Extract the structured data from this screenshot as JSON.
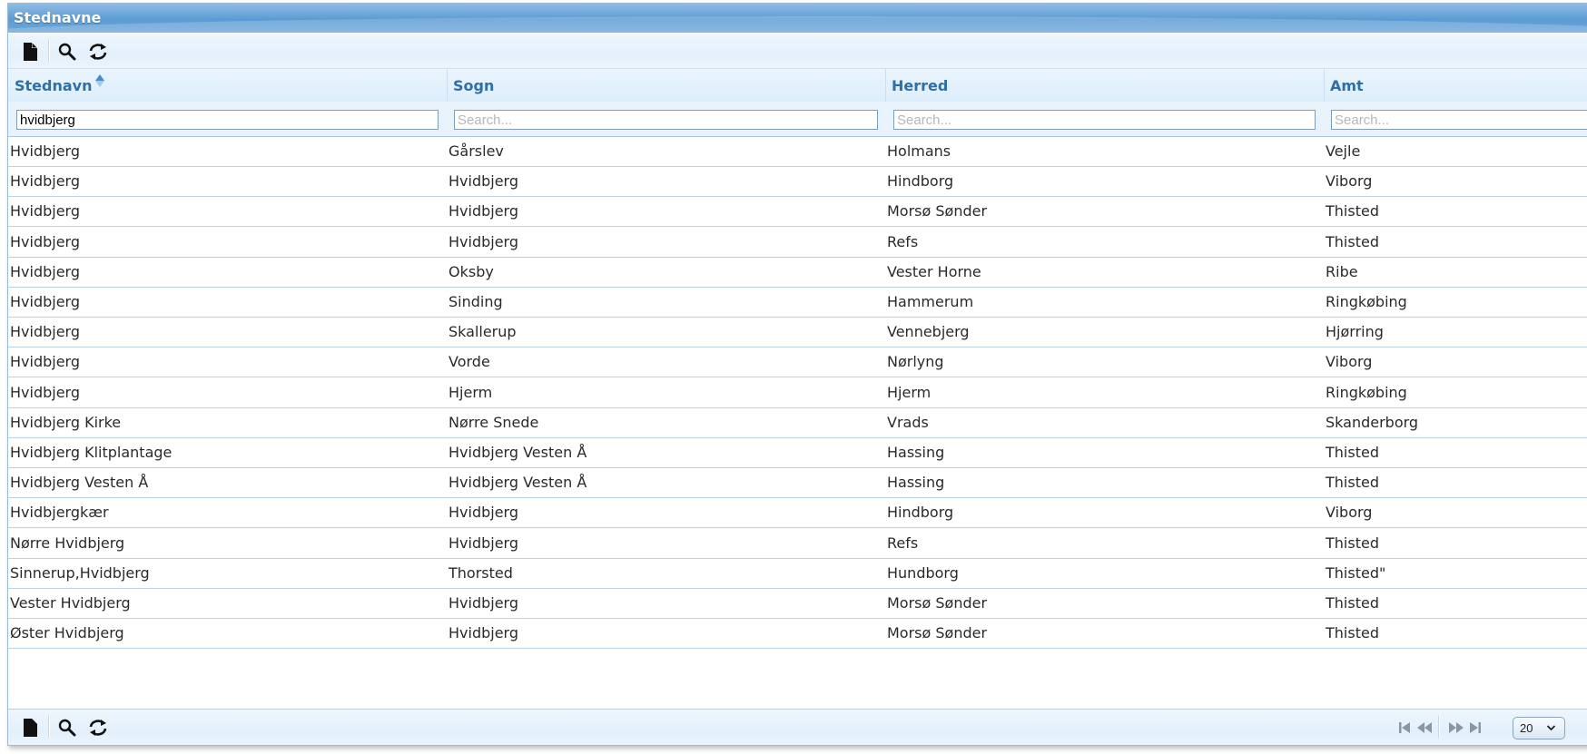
{
  "window": {
    "title": "Stednavne"
  },
  "toolbar": {
    "icons": [
      "new-document-icon",
      "search-icon",
      "refresh-icon"
    ]
  },
  "columns": [
    {
      "label": "Stednavn",
      "filter_value": "hvidbjerg",
      "placeholder": "Search...",
      "sorted": "ascending"
    },
    {
      "label": "Sogn",
      "filter_value": "",
      "placeholder": "Search..."
    },
    {
      "label": "Herred",
      "filter_value": "",
      "placeholder": "Search..."
    },
    {
      "label": "Amt",
      "filter_value": "",
      "placeholder": "Search..."
    }
  ],
  "rows": [
    [
      "Hvidbjerg",
      "Gårslev",
      "Holmans",
      "Vejle"
    ],
    [
      "Hvidbjerg",
      "Hvidbjerg",
      "Hindborg",
      "Viborg"
    ],
    [
      "Hvidbjerg",
      "Hvidbjerg",
      "Morsø Sønder",
      "Thisted"
    ],
    [
      "Hvidbjerg",
      "Hvidbjerg",
      "Refs",
      "Thisted"
    ],
    [
      "Hvidbjerg",
      "Oksby",
      "Vester Horne",
      "Ribe"
    ],
    [
      "Hvidbjerg",
      "Sinding",
      "Hammerum",
      "Ringkøbing"
    ],
    [
      "Hvidbjerg",
      "Skallerup",
      "Vennebjerg",
      "Hjørring"
    ],
    [
      "Hvidbjerg",
      "Vorde",
      "Nørlyng",
      "Viborg"
    ],
    [
      "Hvidbjerg",
      "Hjerm",
      "Hjerm",
      "Ringkøbing"
    ],
    [
      "Hvidbjerg Kirke",
      "Nørre Snede",
      "Vrads",
      "Skanderborg"
    ],
    [
      "Hvidbjerg Klitplantage",
      "Hvidbjerg Vesten Å",
      "Hassing",
      "Thisted"
    ],
    [
      "Hvidbjerg Vesten Å",
      "Hvidbjerg Vesten Å",
      "Hassing",
      "Thisted"
    ],
    [
      "Hvidbjergkær",
      "Hvidbjerg",
      "Hindborg",
      "Viborg"
    ],
    [
      "Nørre Hvidbjerg",
      "Hvidbjerg",
      "Refs",
      "Thisted"
    ],
    [
      "Sinnerup,Hvidbjerg",
      "Thorsted",
      "Hundborg",
      "Thisted\""
    ],
    [
      "Vester Hvidbjerg",
      "Hvidbjerg",
      "Morsø Sønder",
      "Thisted"
    ],
    [
      "Øster Hvidbjerg",
      "Hvidbjerg",
      "Morsø Sønder",
      "Thisted"
    ]
  ],
  "pagination": {
    "icons": [
      "first-page-icon",
      "previous-page-icon",
      "next-page-icon",
      "last-page-icon"
    ],
    "page_size": "20"
  },
  "colors": {
    "header_text": "#2e6fa8",
    "title_bar": "#5b9bd3",
    "row_border": "#b9d2e6"
  }
}
